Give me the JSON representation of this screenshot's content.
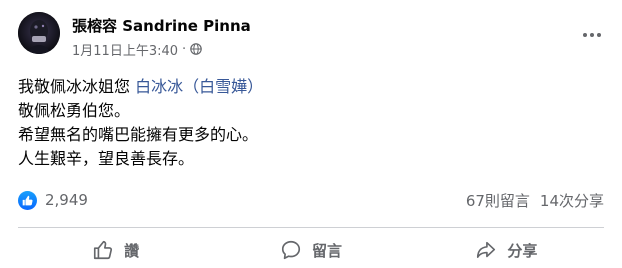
{
  "post": {
    "author": "張榕容 Sandrine Pinna",
    "timestamp": "1月11日上午3:40",
    "separator": "·",
    "audience_icon": "globe-icon",
    "more_icon": "more-horizontal-icon",
    "body": {
      "line1_prefix": "我敬佩冰冰姐您 ",
      "line1_link": "白冰冰（白雪嬅）",
      "line2": "敬佩松勇伯您。",
      "line3": "希望無名的嘴巴能擁有更多的心。",
      "line4": "人生艱辛，望良善長存。"
    },
    "reactions": {
      "icon": "like-icon",
      "count": "2,949"
    },
    "comments": "67則留言",
    "shares": "14次分享"
  },
  "actions": {
    "like_label": "讚",
    "comment_label": "留言",
    "share_label": "分享"
  },
  "colors": {
    "link": "#385898",
    "like_badge": "#0866ff",
    "secondary_text": "#65676b",
    "divider": "#ced0d4"
  }
}
